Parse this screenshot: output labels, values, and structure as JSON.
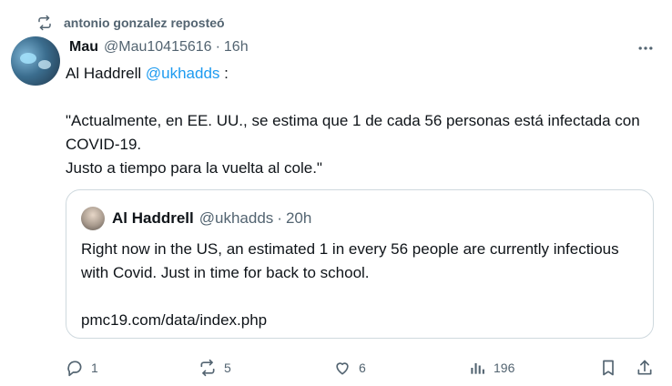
{
  "repost": {
    "label": "antonio gonzalez reposteó",
    "icon": "repost-icon"
  },
  "post": {
    "author_name": "Mau",
    "author_handle": "@Mau10415616",
    "separator": "·",
    "time": "16h",
    "text_intro": "Al Haddrell ",
    "mention": "@ukhadds",
    "text_after_mention": " :",
    "body": "\"Actualmente, en EE. UU., se estima que 1 de cada 56 personas está infectada con COVID-19.\nJusto a tiempo para la vuelta al cole.\""
  },
  "quote": {
    "author_name": "Al Haddrell",
    "author_handle": "@ukhadds",
    "separator": "·",
    "time": "20h",
    "text": "Right now in the US, an estimated 1 in every 56 people are currently infectious with Covid. Just in time for back to school.\n\npmc19.com/data/index.php"
  },
  "actions": {
    "replies": "1",
    "reposts": "5",
    "likes": "6",
    "views": "196"
  },
  "colors": {
    "accent": "#1d9bf0",
    "secondary_text": "#536471",
    "border": "#cfd9de"
  }
}
